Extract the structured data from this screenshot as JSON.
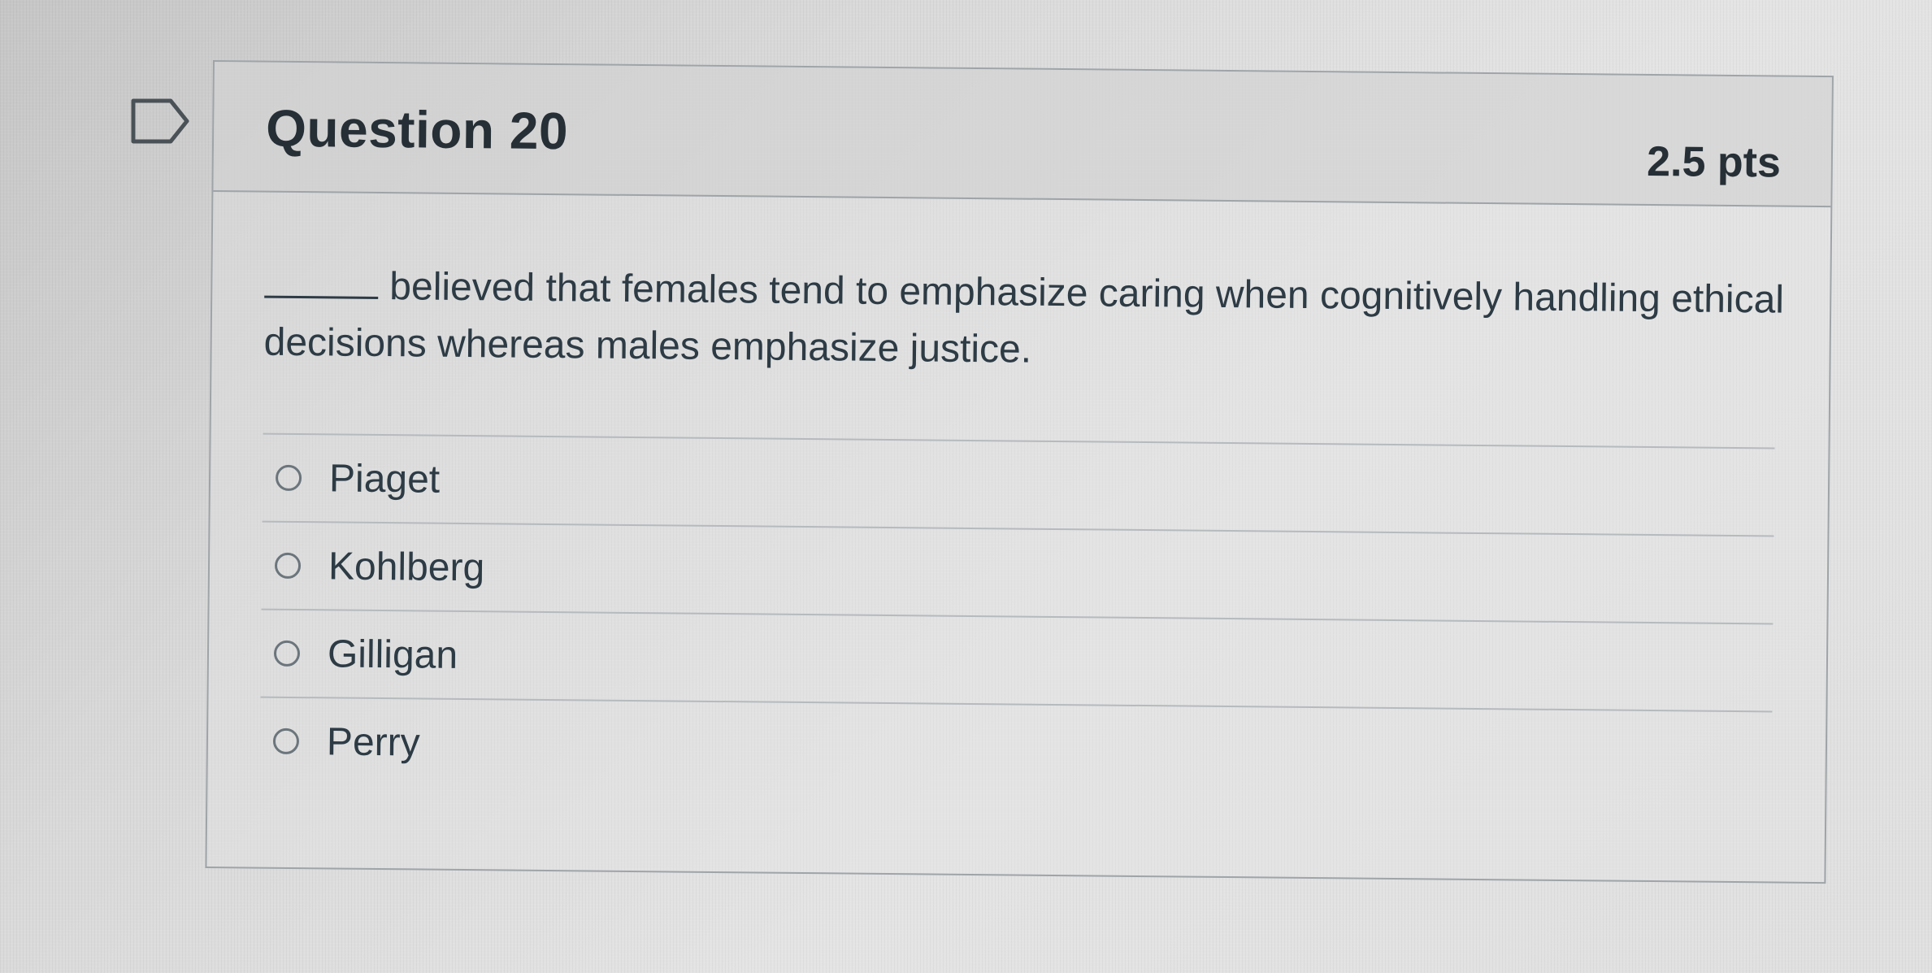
{
  "question": {
    "title": "Question 20",
    "points": "2.5 pts",
    "text": "believed that females tend to emphasize caring when cognitively handling ethical decisions whereas males emphasize justice.",
    "flag_icon": "flag-outline-icon"
  },
  "answers": [
    {
      "label": "Piaget",
      "selected": false
    },
    {
      "label": "Kohlberg",
      "selected": false
    },
    {
      "label": "Gilligan",
      "selected": false
    },
    {
      "label": "Perry",
      "selected": false
    }
  ],
  "colors": {
    "text": "#2d3b45",
    "border": "#9ea4a8"
  }
}
